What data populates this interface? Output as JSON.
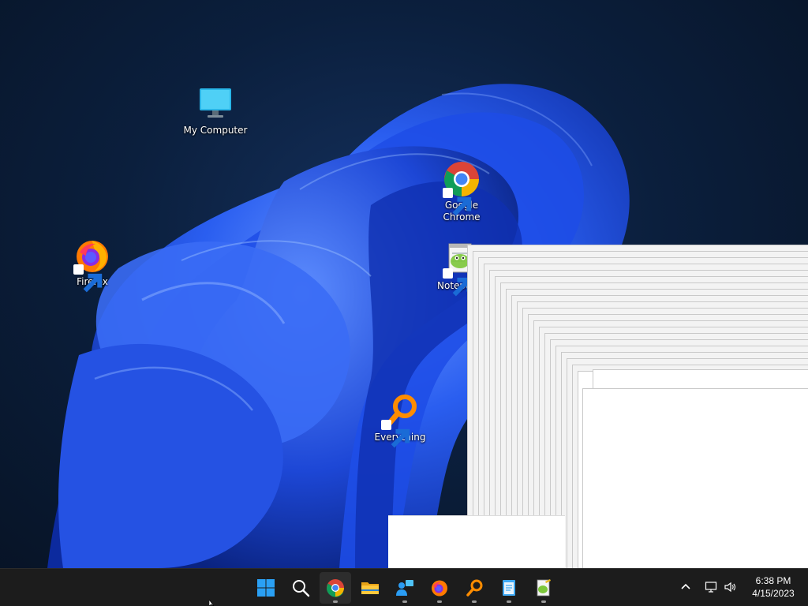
{
  "desktop": {
    "icons": [
      {
        "label": "My Computer",
        "icon": "monitor-icon"
      },
      {
        "label": "Google\nChrome",
        "icon": "chrome-icon"
      },
      {
        "label": "Firefox",
        "icon": "firefox-icon"
      },
      {
        "label": "Notepa",
        "icon": "notepad-plus-icon"
      },
      {
        "label": "Everything",
        "icon": "everything-search-icon"
      }
    ]
  },
  "taskbar": {
    "apps": [
      {
        "icon": "windows-start-icon"
      },
      {
        "icon": "search-icon"
      },
      {
        "icon": "chrome-icon"
      },
      {
        "icon": "file-explorer-icon"
      },
      {
        "icon": "remote-desktop-icon"
      },
      {
        "icon": "firefox-icon"
      },
      {
        "icon": "everything-search-icon"
      },
      {
        "icon": "notepad-icon"
      },
      {
        "icon": "notepad-plus-icon"
      }
    ],
    "tray": {
      "icons": [
        "chevron-up-icon",
        "network-icon",
        "speaker-icon"
      ],
      "time": "6:38 PM",
      "date": "4/15/2023"
    }
  },
  "colors": {
    "wallpaper_dark": "#0b1f3d",
    "bloom_blue": "#1f4fe0",
    "bloom_light": "#4d80ff",
    "taskbar": "#1c1c1c",
    "window_white": "#ffffff"
  }
}
